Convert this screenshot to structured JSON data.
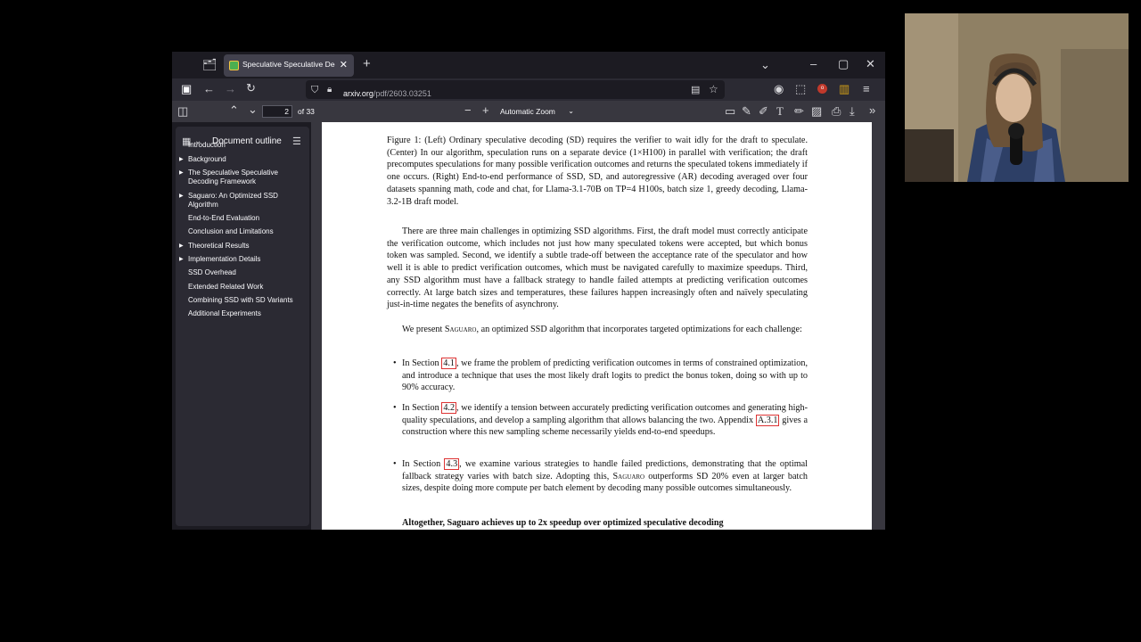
{
  "browser": {
    "tab_title": "Speculative Speculative Decod",
    "url_host": "arxiv.org",
    "url_path": "/pdf/2603.03251"
  },
  "pdf_toolbar": {
    "page_number": "2",
    "page_total": "of 33",
    "zoom": "Automatic Zoom"
  },
  "sidebar": {
    "title": "Document outline",
    "items": [
      {
        "label": "Introduction",
        "expandable": false
      },
      {
        "label": "Background",
        "expandable": true
      },
      {
        "label": "The Speculative Speculative Decoding Framework",
        "expandable": true
      },
      {
        "label": "Saguaro: An Optimized SSD Algorithm",
        "expandable": true
      },
      {
        "label": "End-to-End Evaluation",
        "expandable": false
      },
      {
        "label": "Conclusion and Limitations",
        "expandable": false
      },
      {
        "label": "Theoretical Results",
        "expandable": true
      },
      {
        "label": "Implementation Details",
        "expandable": true
      },
      {
        "label": "SSD Overhead",
        "expandable": false
      },
      {
        "label": "Extended Related Work",
        "expandable": false
      },
      {
        "label": "Combining SSD with SD Variants",
        "expandable": false
      },
      {
        "label": "Additional Experiments",
        "expandable": false
      }
    ]
  },
  "document": {
    "caption": "Figure 1: (Left) Ordinary speculative decoding (SD) requires the verifier to wait idly for the draft to speculate. (Center) In our algorithm, speculation runs on a separate device (1×H100) in parallel with verification; the draft precomputes speculations for many possible verification outcomes and returns the speculated tokens immediately if one occurs. (Right) End-to-end performance of SSD, SD, and autoregressive (AR) decoding averaged over four datasets spanning math, code and chat, for Llama-3.1-70B on TP=4 H100s, batch size 1, greedy decoding, Llama-3.2-1B draft model.",
    "para1": "There are three main challenges in optimizing SSD algorithms. First, the draft model must correctly anticipate the verification outcome, which includes not just how many speculated tokens were accepted, but which bonus token was sampled. Second, we identify a subtle trade-off between the acceptance rate of the speculator and how well it is able to predict verification outcomes, which must be navigated carefully to maximize speedups. Third, any SSD algorithm must have a fallback strategy to handle failed attempts at predicting verification outcomes correctly. At large batch sizes and temperatures, these failures happen increasingly often and naïvely speculating just-in-time negates the benefits of asynchrony.",
    "para2_a": "We present ",
    "para2_name": "Saguaro",
    "para2_b": ", an optimized SSD algorithm that incorporates targeted optimizations for each challenge:",
    "bullet1_a": "In Section ",
    "bullet1_ref": "4.1",
    "bullet1_b": ", we frame the problem of predicting verification outcomes in terms of constrained optimization, and introduce a technique that uses the most likely draft logits to predict the bonus token, doing so with up to 90% accuracy.",
    "bullet2_a": "In Section ",
    "bullet2_ref": "4.2",
    "bullet2_b": ", we identify a tension between accurately predicting verification outcomes and generating high-quality speculations, and develop a sampling algorithm that allows balancing the two. Appendix ",
    "bullet2_ref2": "A.3.1",
    "bullet2_c": " gives a construction where this new sampling scheme necessarily yields end-to-end speedups.",
    "bullet3_a": "In Section ",
    "bullet3_ref": "4.3",
    "bullet3_b": ", we examine various strategies to handle failed predictions, demonstrating that the optimal fallback strategy varies with batch size. Adopting this, ",
    "bullet3_name": "Saguaro",
    "bullet3_c": " outperforms SD 20% even at larger batch sizes, despite doing more compute per batch element by decoding many possible outcomes simultaneously.",
    "bottom_line": "Altogether, Saguaro achieves up to 2x speedup over optimized speculative decoding"
  },
  "icons": {
    "tab_overview": "folder-tabs-icon",
    "new_tab": "plus-icon",
    "list_all_tabs": "chevron-down-icon",
    "minimize": "minimize-icon",
    "maximize": "maximize-icon",
    "close": "close-icon"
  },
  "colors": {
    "window_bg": "#1c1b22",
    "toolbar_bg": "#2b2a33",
    "pdf_toolbar_bg": "#38373f",
    "link_box": "#dd3333"
  }
}
